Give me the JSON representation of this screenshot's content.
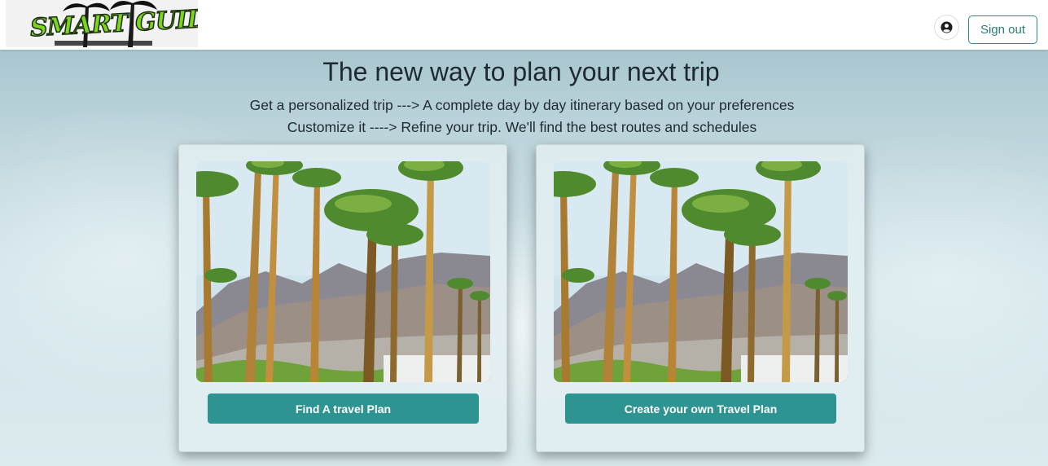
{
  "header": {
    "logo_text": "SMART GUIDE",
    "user_icon": "user-circle-icon",
    "signout_label": "Sign out"
  },
  "hero": {
    "title": "The new way to plan your next trip",
    "line1": "Get a personalized trip ---> A complete day by day itinerary based on your preferences",
    "line2": "Customize it ----> Refine your trip. We'll find the best routes and schedules"
  },
  "cards": [
    {
      "image": "palm-trees-mountains-photo",
      "button_label": "Find A travel Plan"
    },
    {
      "image": "palm-trees-mountains-photo",
      "button_label": "Create your own Travel Plan"
    }
  ],
  "colors": {
    "accent": "#2e9492",
    "signout_border": "#2e8b8b",
    "logo_green": "#7bd61b"
  }
}
